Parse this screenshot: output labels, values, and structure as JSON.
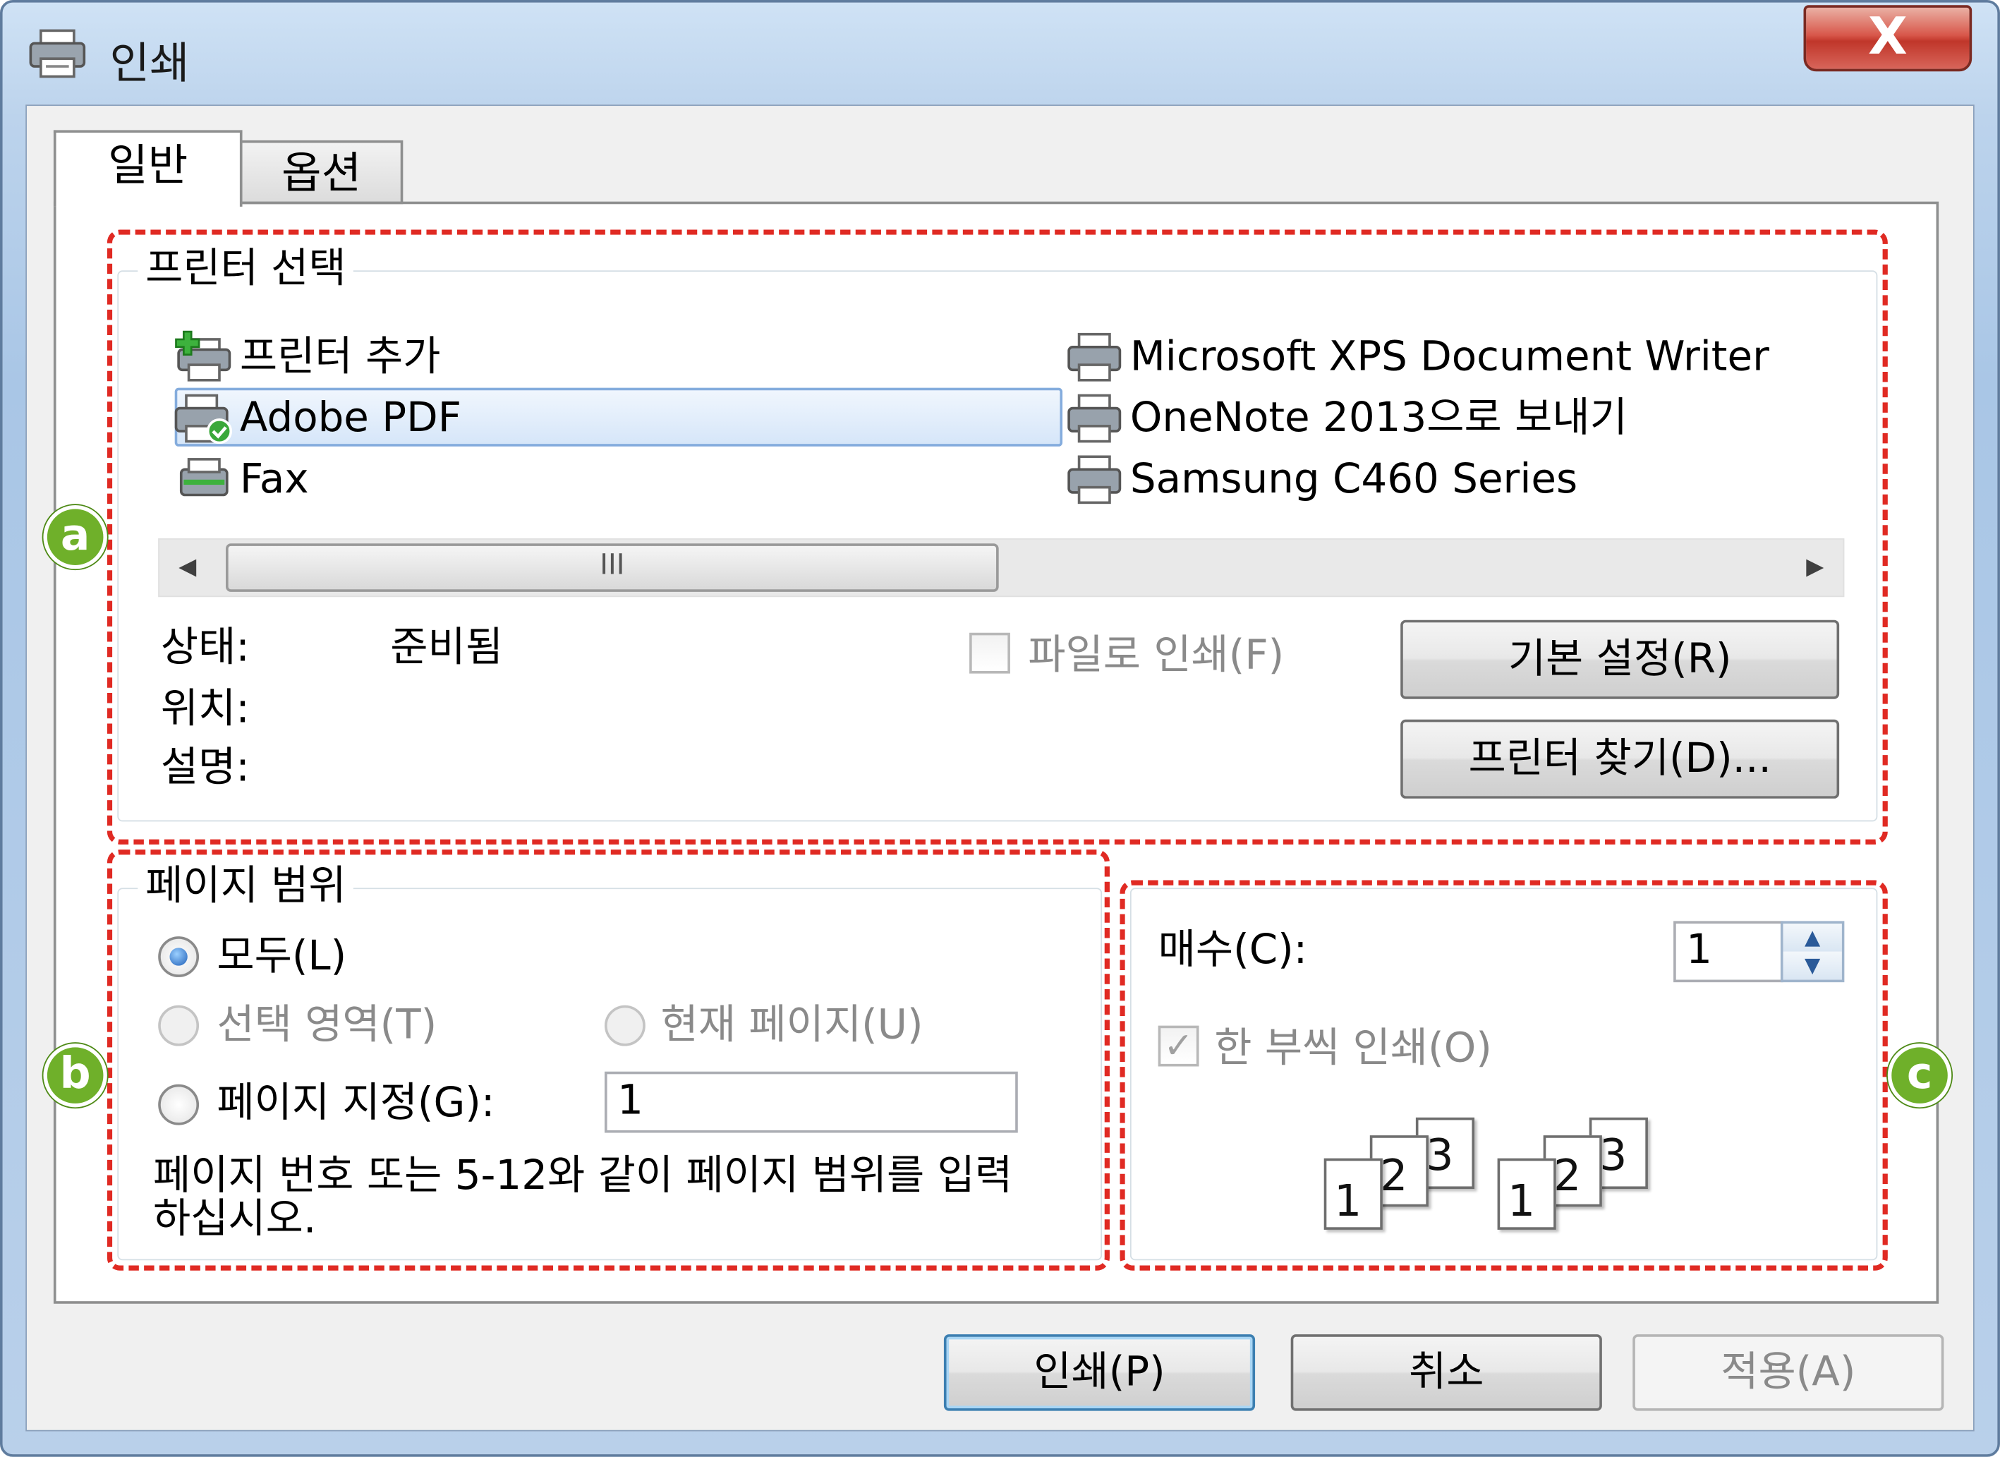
{
  "window": {
    "title": "인쇄",
    "close_label": "X"
  },
  "tabs": [
    {
      "label": "일반",
      "active": true
    },
    {
      "label": "옵션",
      "active": false
    }
  ],
  "printer_group": {
    "legend": "프린터 선택",
    "printers": [
      {
        "name": "프린터 추가",
        "icon": "add-printer-icon"
      },
      {
        "name": "Microsoft XPS Document Writer",
        "icon": "printer-icon"
      },
      {
        "name": "Adobe PDF",
        "icon": "default-printer-icon",
        "selected": true
      },
      {
        "name": "OneNote 2013으로 보내기",
        "icon": "printer-icon"
      },
      {
        "name": "Fax",
        "icon": "fax-icon"
      },
      {
        "name": "Samsung C460 Series",
        "icon": "printer-icon"
      }
    ],
    "scrollbar": {
      "thumb_grip": "III",
      "left_arrow": "◀",
      "right_arrow": "▶"
    },
    "status_label": "상태:",
    "status_value": "준비됨",
    "location_label": "위치:",
    "comment_label": "설명:",
    "print_to_file_label": "파일로 인쇄(F)",
    "print_to_file_checked": false,
    "preferences_button": "기본 설정(R)",
    "find_printer_button": "프린터 찾기(D)..."
  },
  "page_range": {
    "legend": "페이지 범위",
    "all_label": "모두(L)",
    "selection_label": "선택 영역(T)",
    "current_page_label": "현재 페이지(U)",
    "pages_label": "페이지 지정(G):",
    "pages_value": "1",
    "selected_option": "all",
    "hint": "페이지 번호 또는 5-12와 같이 페이지 범위를 입력하십시오."
  },
  "copies": {
    "label": "매수(C):",
    "value": "1",
    "collate_label": "한 부씩 인쇄(O)",
    "collate_checked": true,
    "collate_sets": [
      [
        "1",
        "2",
        "3"
      ],
      [
        "1",
        "2",
        "3"
      ]
    ]
  },
  "buttons": {
    "print": "인쇄(P)",
    "cancel": "취소",
    "apply": "적용(A)"
  },
  "annotations": {
    "markers": [
      "a",
      "b",
      "c"
    ],
    "color": "#e02a23",
    "marker_color": "#6fb02a"
  }
}
